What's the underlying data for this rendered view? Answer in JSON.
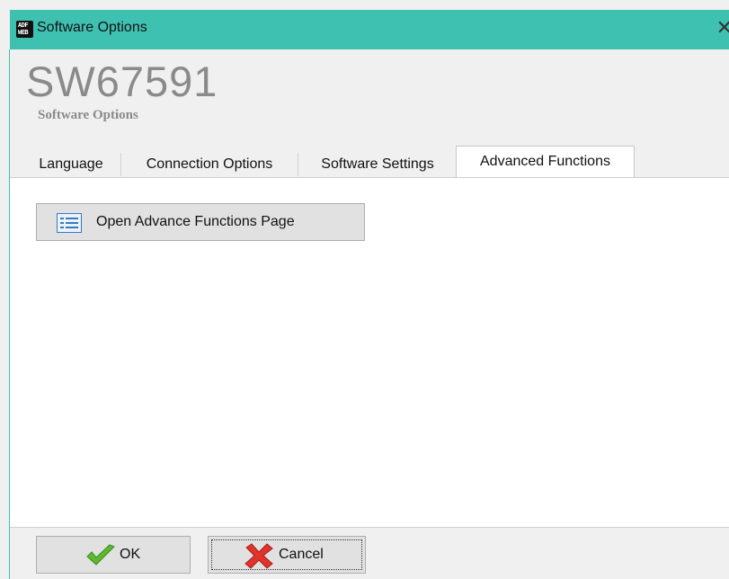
{
  "window": {
    "title": "Software Options",
    "app_icon_text": [
      "ADF",
      "WEB"
    ]
  },
  "header": {
    "product_code": "SW67591",
    "subtitle": "Software Options"
  },
  "tabs": [
    {
      "label": "Language",
      "active": false
    },
    {
      "label": "Connection Options",
      "active": false
    },
    {
      "label": "Software Settings",
      "active": false
    },
    {
      "label": "Advanced Functions",
      "active": true
    }
  ],
  "advanced": {
    "open_button_label": "Open Advance Functions Page",
    "open_button_icon": "list-icon"
  },
  "footer": {
    "ok_label": "OK",
    "ok_icon": "checkmark-icon",
    "cancel_label": "Cancel",
    "cancel_icon": "x-icon"
  },
  "colors": {
    "titlebar": "#3fc1b2",
    "title_gray": "#8a8a8a",
    "ok_green": "#5cb82e",
    "cancel_red": "#e0332a"
  }
}
